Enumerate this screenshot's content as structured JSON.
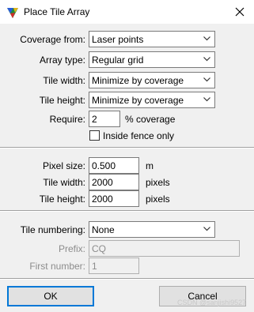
{
  "dialog": {
    "title": "Place Tile Array",
    "close_label": "×"
  },
  "section_tiles": {
    "coverage_from": {
      "label": "Coverage from:",
      "value": "Laser points"
    },
    "array_type": {
      "label": "Array type:",
      "value": "Regular grid"
    },
    "tile_width": {
      "label": "Tile width:",
      "value": "Minimize by coverage"
    },
    "tile_height": {
      "label": "Tile height:",
      "value": "Minimize by coverage"
    },
    "require": {
      "label": "Require:",
      "value": "2",
      "unit": "% coverage"
    },
    "inside_fence": {
      "label": "Inside fence only",
      "checked": false
    }
  },
  "section_pixels": {
    "pixel_size": {
      "label": "Pixel size:",
      "value": "0.500",
      "unit": "m"
    },
    "tile_width": {
      "label": "Tile width:",
      "value": "2000",
      "unit": "pixels"
    },
    "tile_height": {
      "label": "Tile height:",
      "value": "2000",
      "unit": "pixels"
    }
  },
  "section_numbering": {
    "tile_numbering": {
      "label": "Tile numbering:",
      "value": "None"
    },
    "prefix": {
      "label": "Prefix:",
      "value": "CQ"
    },
    "first_number": {
      "label": "First number:",
      "value": "1"
    }
  },
  "buttons": {
    "ok": "OK",
    "cancel": "Cancel"
  },
  "watermark": "CSDN @sanjishi9527",
  "colors": {
    "default_button_border": "#0078d7",
    "disabled_text": "#8c8c8c"
  }
}
